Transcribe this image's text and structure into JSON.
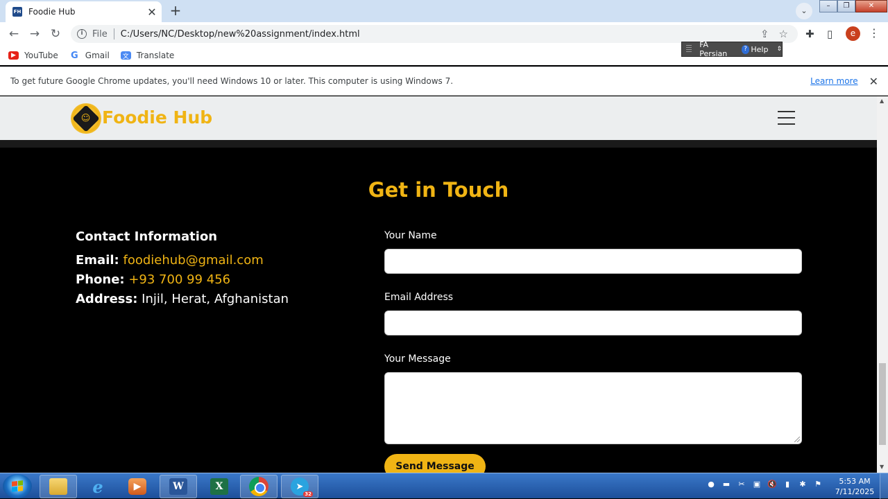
{
  "browser": {
    "tab": {
      "favicon": "FH",
      "title": "Foodie Hub",
      "close": "✕"
    },
    "new_tab": "+",
    "tab_search": "⌄",
    "window_buttons": {
      "minimize": "–",
      "maximize": "❐",
      "close": "✕"
    },
    "nav": {
      "back": "←",
      "forward": "→",
      "reload": "↻"
    },
    "omnibox": {
      "info": "i",
      "scheme": "File",
      "url": "C:/Users/NC/Desktop/new%20assignment/index.html"
    },
    "toolbar_icons": {
      "share": "⇪",
      "star": "☆",
      "extensions": "✚",
      "sidepanel": "▯",
      "profile": "e",
      "menu": "⋮"
    },
    "bookmarks": [
      {
        "label": "YouTube",
        "icon": "youtube-icon"
      },
      {
        "label": "Gmail",
        "icon": "google-icon"
      },
      {
        "label": "Translate",
        "icon": "translate-icon"
      }
    ],
    "language_bar": {
      "language": "FA Persian",
      "help": "Help",
      "help_icon": "?",
      "options": "⇕"
    },
    "infobar": {
      "message": "To get future Google Chrome updates, you'll need Windows 10 or later. This computer is using Windows 7.",
      "link": "Learn more",
      "close": "✕"
    }
  },
  "site": {
    "brand": "Foodie Hub",
    "logo_glyph": "☺",
    "section_title": "Get in Touch",
    "contact": {
      "heading": "Contact Information",
      "email_label": "Email:",
      "email_value": "foodiehub@gmail.com",
      "phone_label": "Phone:",
      "phone_value": "+93 700 99 456",
      "address_label": "Address:",
      "address_value": "Injil, Herat, Afghanistan"
    },
    "form": {
      "name_label": "Your Name",
      "name_value": "",
      "email_label": "Email Address",
      "email_value": "",
      "message_label": "Your Message",
      "message_value": "",
      "submit_label": "Send Message"
    },
    "colors": {
      "accent": "#f0b414",
      "background": "#000000",
      "nav_bg": "#eceeef"
    }
  },
  "taskbar": {
    "items": [
      {
        "name": "explorer",
        "glyph": "",
        "active": true
      },
      {
        "name": "internet-explorer",
        "glyph": "e",
        "active": false
      },
      {
        "name": "media-player",
        "glyph": "▶",
        "active": false
      },
      {
        "name": "word",
        "glyph": "W",
        "active": true
      },
      {
        "name": "excel",
        "glyph": "X",
        "active": false
      },
      {
        "name": "chrome",
        "glyph": "",
        "active": true
      },
      {
        "name": "telegram",
        "glyph": "➤",
        "badge": "32",
        "active": true
      }
    ],
    "tray_icons": [
      "●",
      "▬",
      "✂",
      "▣",
      "🔇",
      "▮",
      "✱",
      "⚑"
    ],
    "time": "5:53 AM",
    "date": "7/11/2025"
  }
}
